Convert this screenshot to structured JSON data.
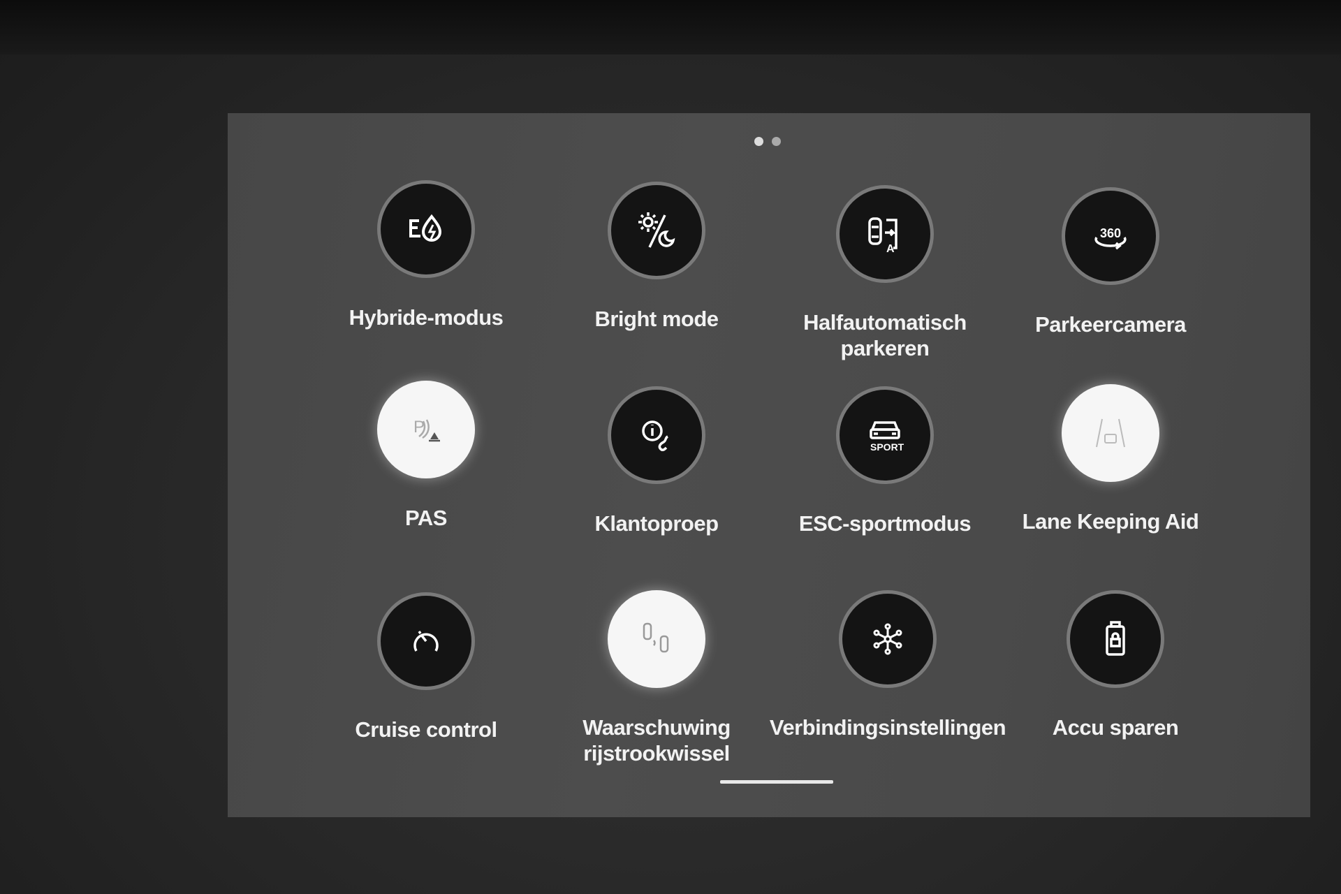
{
  "pager": {
    "pages": 2,
    "current": 1
  },
  "tiles": [
    {
      "label": "Hybride-modus",
      "icon": "hybrid-mode-icon",
      "active": false
    },
    {
      "label": "Bright mode",
      "icon": "sun-moon-icon",
      "active": false
    },
    {
      "label": "Halfautomatisch parkeren",
      "icon": "semi-auto-parking-icon",
      "active": false
    },
    {
      "label": "Parkeercamera",
      "icon": "camera-360-icon",
      "active": false
    },
    {
      "label": "PAS",
      "icon": "parking-sensor-icon",
      "active": true
    },
    {
      "label": "Klantoproep",
      "icon": "info-call-icon",
      "active": false
    },
    {
      "label": "ESC-sportmodus",
      "icon": "car-sport-icon",
      "active": false
    },
    {
      "label": "Lane Keeping Aid",
      "icon": "lane-keeping-icon",
      "active": true
    },
    {
      "label": "Cruise control",
      "icon": "speedometer-icon",
      "active": false
    },
    {
      "label": "Waarschuwing rijstrookwissel",
      "icon": "lane-change-warning-icon",
      "active": true
    },
    {
      "label": "Verbindingsinstellingen",
      "icon": "connectivity-icon",
      "active": false
    },
    {
      "label": "Accu sparen",
      "icon": "battery-lock-icon",
      "active": false
    }
  ],
  "icon_text": {
    "camera": "360",
    "sport": "SPORT",
    "parking": "P",
    "auto": "A"
  }
}
